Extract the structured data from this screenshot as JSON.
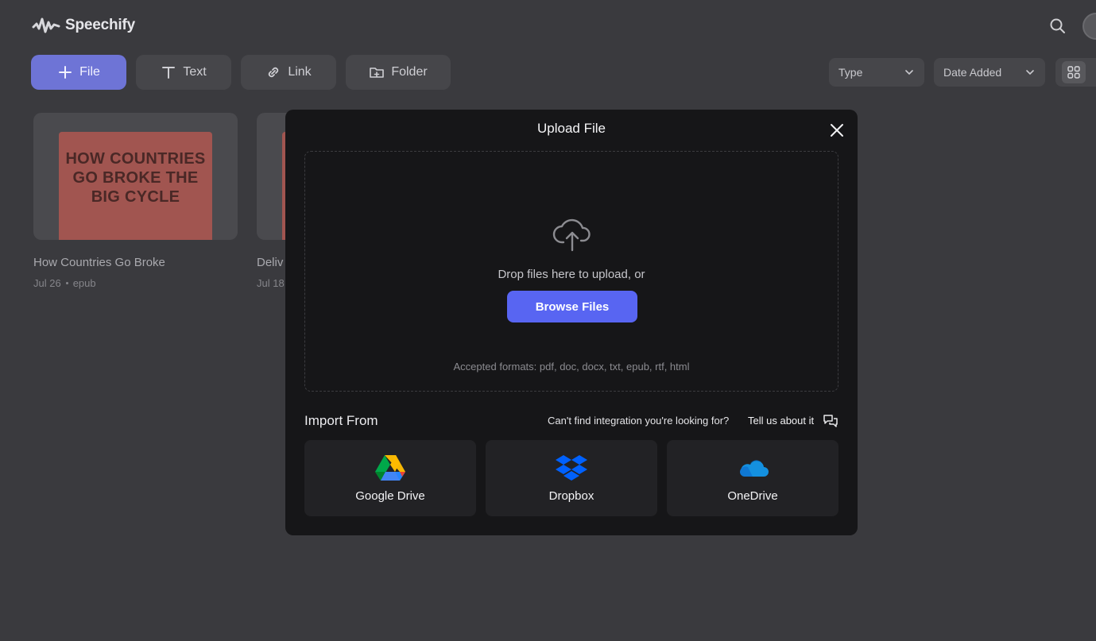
{
  "app": {
    "name": "Speechify",
    "actions": [
      {
        "label": "File",
        "icon": "plus-icon"
      },
      {
        "label": "Text",
        "icon": "text-icon"
      },
      {
        "label": "Link",
        "icon": "link-icon"
      },
      {
        "label": "Folder",
        "icon": "folder-plus-icon"
      }
    ],
    "filters": {
      "type": "Type",
      "date": "Date Added"
    },
    "library": [
      {
        "title": "How Countries Go Broke",
        "date": "Jul 26",
        "format": "epub",
        "cover_text": "HOW COUNTRIES GO BROKE THE BIG CYCLE"
      },
      {
        "title": "Deliv",
        "date": "Jul 18"
      }
    ]
  },
  "modal": {
    "title": "Upload File",
    "drop_text": "Drop files here to upload, or",
    "browse_label": "Browse Files",
    "formats_text": "Accepted formats: pdf, doc, docx, txt, epub, rtf, html",
    "import_title": "Import From",
    "integration_question": "Can't find integration you're looking for?",
    "tell_us": "Tell us about it",
    "sources": [
      {
        "label": "Google Drive",
        "icon": "google-drive-icon"
      },
      {
        "label": "Dropbox",
        "icon": "dropbox-icon"
      },
      {
        "label": "OneDrive",
        "icon": "onedrive-icon"
      }
    ]
  },
  "colors": {
    "accent": "#5865f2",
    "modal_bg": "#161618",
    "page_dim": "#3a3a3e"
  }
}
